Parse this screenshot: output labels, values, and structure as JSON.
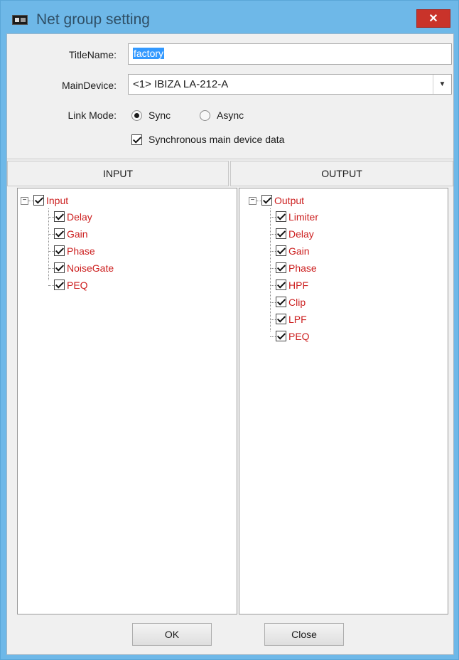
{
  "window": {
    "title": "Net group setting",
    "close_glyph": "✕"
  },
  "form": {
    "title_name_label": "TitleName:",
    "title_name_value": "factory",
    "main_device_label": "MainDevice:",
    "main_device_value": "<1> IBIZA LA-212-A",
    "link_mode_label": "Link Mode:",
    "link_mode_options": [
      {
        "label": "Sync",
        "selected": true
      },
      {
        "label": "Async",
        "selected": false
      }
    ],
    "sync_main_label": "Synchronous main device data",
    "sync_main_checked": true
  },
  "input_panel": {
    "header": "INPUT",
    "root": {
      "label": "Input",
      "checked": true,
      "expanded": true
    },
    "children": [
      {
        "label": "Delay",
        "checked": true
      },
      {
        "label": "Gain",
        "checked": true
      },
      {
        "label": "Phase",
        "checked": true
      },
      {
        "label": "NoiseGate",
        "checked": true
      },
      {
        "label": "PEQ",
        "checked": true
      }
    ]
  },
  "output_panel": {
    "header": "OUTPUT",
    "root": {
      "label": "Output",
      "checked": true,
      "expanded": true
    },
    "children": [
      {
        "label": "Limiter",
        "checked": true
      },
      {
        "label": "Delay",
        "checked": true
      },
      {
        "label": "Gain",
        "checked": true
      },
      {
        "label": "Phase",
        "checked": true
      },
      {
        "label": "HPF",
        "checked": true
      },
      {
        "label": "Clip",
        "checked": true
      },
      {
        "label": "LPF",
        "checked": true
      },
      {
        "label": "PEQ",
        "checked": true
      }
    ]
  },
  "buttons": {
    "ok_label": "OK",
    "close_label": "Close"
  },
  "colors": {
    "title_bar": "#6eb8e8",
    "close_button": "#c9332a",
    "tree_label": "#cc1f1f",
    "selection": "#3399ff"
  },
  "icons": {
    "app": "app-icon",
    "close": "close-icon",
    "dropdown": "chevron-down-icon",
    "expander": "minus-box-icon"
  }
}
